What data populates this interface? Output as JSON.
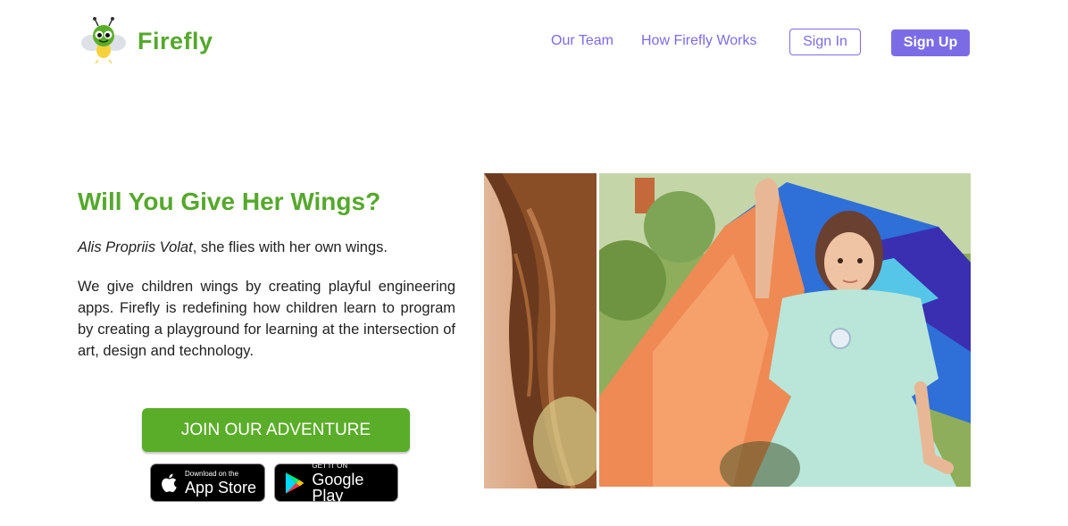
{
  "header": {
    "brand": "Firefly",
    "nav": [
      "Our Team",
      "How Firefly Works"
    ],
    "sign_in": "Sign In",
    "sign_up": "Sign Up"
  },
  "hero": {
    "title": "Will You Give Her Wings?",
    "tagline_italic": "Alis Propriis Volat",
    "tagline_rest": ", she flies with her own wings.",
    "description": "We give children wings by creating playful engineering apps. Firefly is redefining how children learn to program by creating a playground for learning at the intersection of art, design and technology.",
    "cta": "JOIN OUR ADVENTURE"
  },
  "badges": {
    "app_store_small": "Download on the",
    "app_store_big": "App Store",
    "google_small": "GET IT ON",
    "google_big": "Google Play"
  },
  "colors": {
    "brand_green": "#55a82c",
    "accent_purple": "#7b6ce6",
    "cta_green": "#5aad29"
  },
  "icons": [
    "firefly-logo-icon",
    "apple-icon",
    "google-play-icon"
  ]
}
